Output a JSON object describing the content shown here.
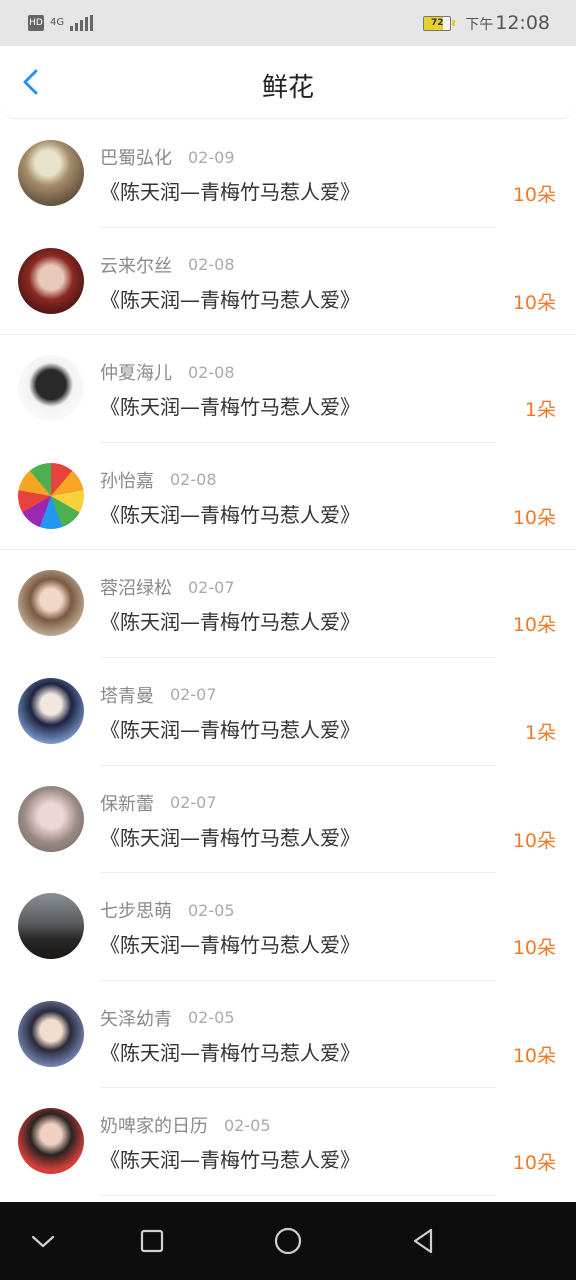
{
  "status_bar": {
    "hd": "HD",
    "network": "4G",
    "battery_percent": "72",
    "time_prefix": "下午",
    "time": "12:08"
  },
  "header": {
    "title": "鲜花",
    "back_icon": "chevron-left-icon"
  },
  "items": [
    {
      "name": "巴蜀弘化",
      "date": "02-09",
      "book": "《陈天润—青梅竹马惹人爱》",
      "count": "10朵"
    },
    {
      "name": "云来尔丝",
      "date": "02-08",
      "book": "《陈天润—青梅竹马惹人爱》",
      "count": "10朵"
    },
    {
      "name": "仲夏海儿",
      "date": "02-08",
      "book": "《陈天润—青梅竹马惹人爱》",
      "count": "1朵"
    },
    {
      "name": "孙怡嘉",
      "date": "02-08",
      "book": "《陈天润—青梅竹马惹人爱》",
      "count": "10朵"
    },
    {
      "name": "蓉沼绿松",
      "date": "02-07",
      "book": "《陈天润—青梅竹马惹人爱》",
      "count": "10朵"
    },
    {
      "name": "塔青曼",
      "date": "02-07",
      "book": "《陈天润—青梅竹马惹人爱》",
      "count": "1朵"
    },
    {
      "name": "保新蕾",
      "date": "02-07",
      "book": "《陈天润—青梅竹马惹人爱》",
      "count": "10朵"
    },
    {
      "name": "七步思萌",
      "date": "02-05",
      "book": "《陈天润—青梅竹马惹人爱》",
      "count": "10朵"
    },
    {
      "name": "矢泽幼青",
      "date": "02-05",
      "book": "《陈天润—青梅竹马惹人爱》",
      "count": "10朵"
    },
    {
      "name": "奶啤家的日历",
      "date": "02-05",
      "book": "《陈天润—青梅竹马惹人爱》",
      "count": "10朵"
    }
  ],
  "nav_bar": {
    "icons": [
      "chevron-down-icon",
      "square-icon",
      "circle-icon",
      "triangle-back-icon"
    ]
  },
  "colors": {
    "accent": "#2a8ff0",
    "count": "#f07a2a"
  }
}
